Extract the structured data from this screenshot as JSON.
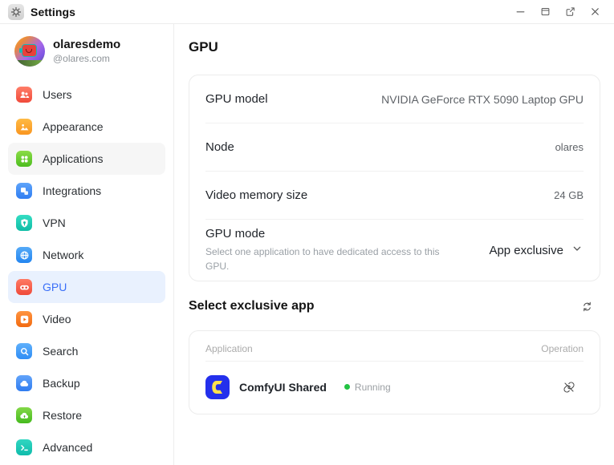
{
  "titlebar": {
    "title": "Settings",
    "app_icon": "settings-gear-icon",
    "controls": {
      "minimize": "minimize-icon",
      "maximize": "window-restore-icon",
      "open_external": "open-in-new-icon",
      "close": "close-icon"
    }
  },
  "sidebar": {
    "profile": {
      "name": "olaresdemo",
      "handle": "@olares.com"
    },
    "items": [
      {
        "label": "Users",
        "icon": "users-icon",
        "state": "normal"
      },
      {
        "label": "Appearance",
        "icon": "appearance-icon",
        "state": "normal"
      },
      {
        "label": "Applications",
        "icon": "applications-icon",
        "state": "hover"
      },
      {
        "label": "Integrations",
        "icon": "integrations-icon",
        "state": "normal"
      },
      {
        "label": "VPN",
        "icon": "vpn-icon",
        "state": "normal"
      },
      {
        "label": "Network",
        "icon": "network-icon",
        "state": "normal"
      },
      {
        "label": "GPU",
        "icon": "gpu-icon",
        "state": "selected"
      },
      {
        "label": "Video",
        "icon": "video-icon",
        "state": "normal"
      },
      {
        "label": "Search",
        "icon": "search-icon",
        "state": "normal"
      },
      {
        "label": "Backup",
        "icon": "backup-icon",
        "state": "normal"
      },
      {
        "label": "Restore",
        "icon": "restore-icon",
        "state": "normal"
      },
      {
        "label": "Advanced",
        "icon": "advanced-icon",
        "state": "normal"
      }
    ]
  },
  "main": {
    "page_title": "GPU",
    "info_rows": [
      {
        "label": "GPU model",
        "value": "NVIDIA GeForce RTX 5090 Laptop GPU"
      },
      {
        "label": "Node",
        "value": "olares"
      },
      {
        "label": "Video memory size",
        "value": "24 GB"
      },
      {
        "label": "GPU mode",
        "description": "Select one application to have dedicated access to this GPU.",
        "value": "App exclusive",
        "control": "dropdown"
      }
    ],
    "exclusive": {
      "title": "Select exclusive app",
      "refresh_icon": "refresh-icon",
      "headers": {
        "application": "Application",
        "operation": "Operation"
      },
      "apps": [
        {
          "name": "ComfyUI Shared",
          "status": "Running",
          "operation_icon": "unbind-icon"
        }
      ]
    }
  },
  "colors": {
    "accent_blue": "#3A6FF8",
    "selected_bg": "#E9F1FE",
    "running_green": "#23C343",
    "comfy_blue": "#2430EC",
    "comfy_yellow": "#FFE14D",
    "border": "#ECECEC",
    "value_gray": "#5F6368"
  }
}
